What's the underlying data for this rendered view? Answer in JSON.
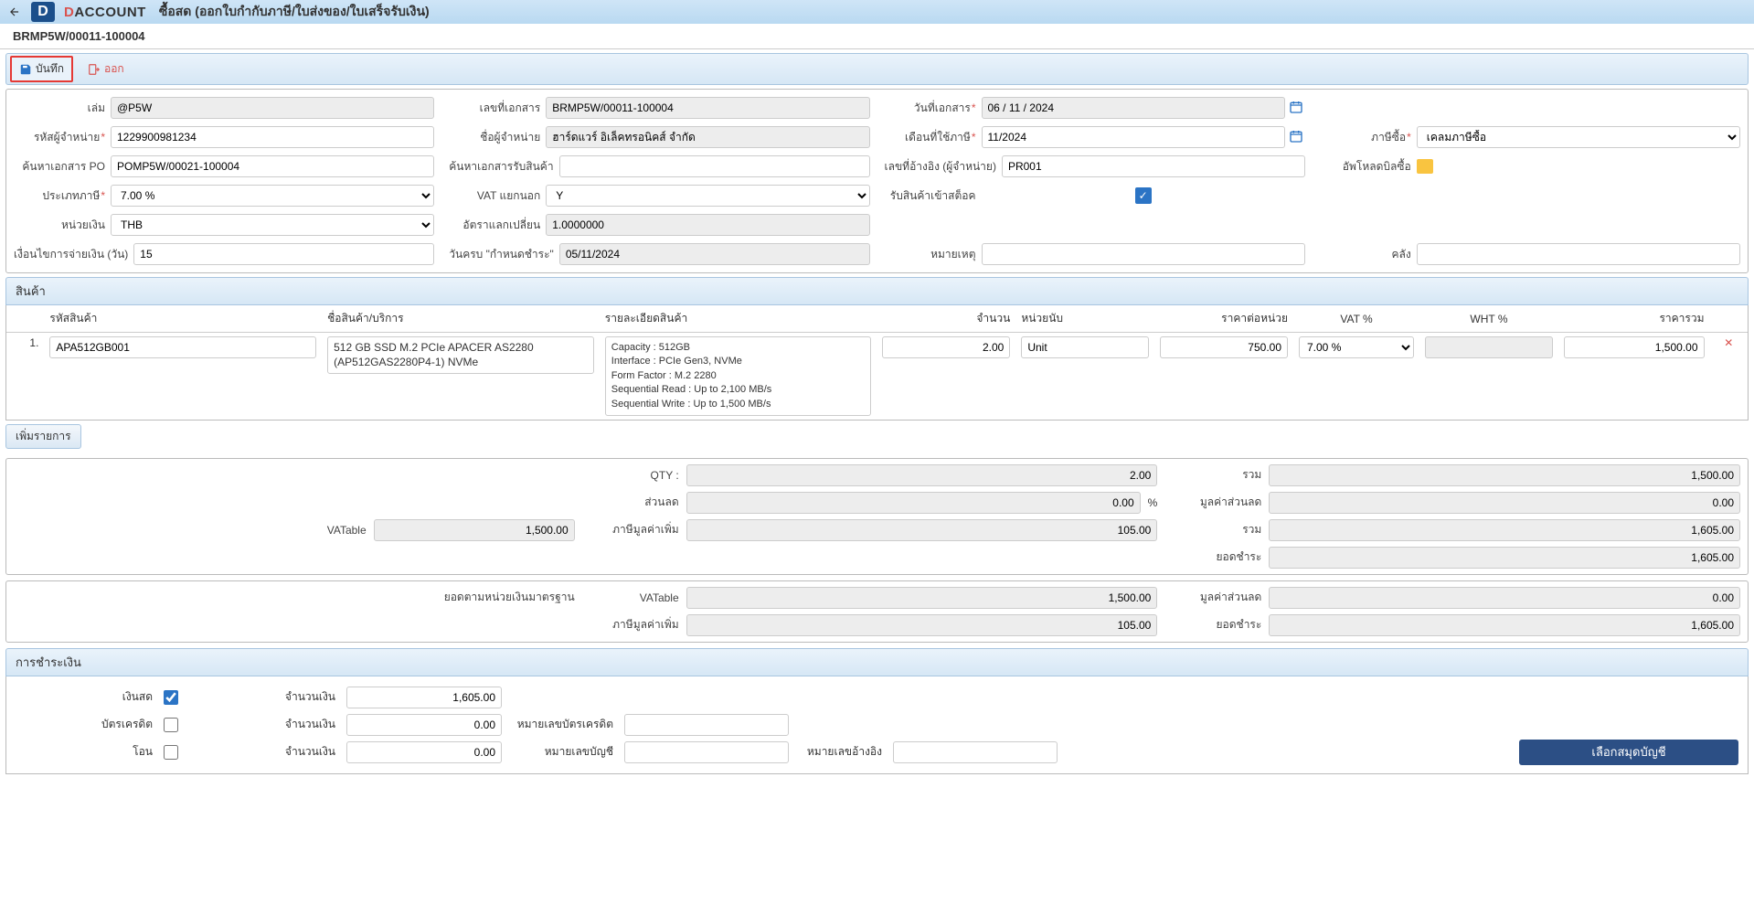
{
  "header": {
    "brand_prefix": "D",
    "brand_rest": "ACCOUNT",
    "page_title": "ซื้อสด (ออกใบกำกับภาษี/ใบส่งของ/ใบเสร็จรับเงิน)"
  },
  "doc_bar": {
    "doc_id": "BRMP5W/00011-100004"
  },
  "toolbar": {
    "save": "บันทึก",
    "exit": "ออก"
  },
  "form": {
    "book_label": "เล่ม",
    "book_value": "@P5W",
    "docno_label": "เลขที่เอกสาร",
    "docno_value": "BRMP5W/00011-100004",
    "docdate_label": "วันที่เอกสาร",
    "docdate_value": "06 / 11 / 2024",
    "vendorcode_label": "รหัสผู้จำหน่าย",
    "vendorcode_value": "1229900981234",
    "vendorname_label": "ชื่อผู้จำหน่าย",
    "vendorname_value": "ฮาร์ดแวร์ อิเล็คทรอนิคส์ จำกัด",
    "taxmonth_label": "เดือนที่ใช้ภาษี",
    "taxmonth_value": "11/2024",
    "buytax_label": "ภาษีซื้อ",
    "buytax_value": "เคลมภาษีซื้อ",
    "po_label": "ค้นหาเอกสาร PO",
    "po_value": "POMP5W/00021-100004",
    "recv_label": "ค้นหาเอกสารรับสินค้า",
    "recv_value": "",
    "ref_label": "เลขที่อ้างอิง (ผู้จำหน่าย)",
    "ref_value": "PR001",
    "upload_label": "อัพโหลดบิลซื้อ",
    "vattype_label": "ประเภทภาษี",
    "vattype_value": "7.00 %",
    "vatexcl_label": "VAT แยกนอก",
    "vatexcl_value": "Y",
    "stockin_label": "รับสินค้าเข้าสต็อค",
    "currency_label": "หน่วยเงิน",
    "currency_value": "THB",
    "rate_label": "อัตราแลกเปลี่ยน",
    "rate_value": "1.0000000",
    "credit_label": "เงื่อนไขการจ่ายเงิน (วัน)",
    "credit_value": "15",
    "due_label": "วันครบ \"กำหนดชำระ\"",
    "due_value": "05/11/2024",
    "note_label": "หมายเหตุ",
    "note_value": "",
    "warehouse_label": "คลัง",
    "warehouse_value": ""
  },
  "items_section": "สินค้า",
  "items": {
    "headers": {
      "code": "รหัสสินค้า",
      "name": "ชื่อสินค้า/บริการ",
      "detail": "รายละเอียดสินค้า",
      "qty": "จำนวน",
      "unit": "หน่วยนับ",
      "price": "ราคาต่อหน่วย",
      "vat": "VAT %",
      "wht": "WHT %",
      "total": "ราคารวม"
    },
    "rows": [
      {
        "no": "1.",
        "code": "APA512GB001",
        "name": "512 GB SSD M.2 PCIe APACER AS2280 (AP512GAS2280P4-1) NVMe",
        "detail": "Capacity : 512GB\nInterface : PCIe Gen3, NVMe\nForm Factor : M.2 2280\nSequential Read : Up to 2,100 MB/s\nSequential Write : Up to 1,500 MB/s",
        "qty": "2.00",
        "unit": "Unit",
        "price": "750.00",
        "vat": "7.00 %",
        "total": "1,500.00"
      }
    ]
  },
  "add_row": "เพิ่มรายการ",
  "totals": {
    "qty_label": "QTY :",
    "qty_value": "2.00",
    "sum_label": "รวม",
    "sum_value": "1,500.00",
    "discount_label": "ส่วนลด",
    "discount_value": "0.00",
    "discount_pct": "%",
    "discount_amt_label": "มูลค่าส่วนลด",
    "discount_amt_value": "0.00",
    "vatable_label": "VATable",
    "vatable_value": "1,500.00",
    "vat_label": "ภาษีมูลค่าเพิ่ม",
    "vat_value": "105.00",
    "grand_label": "รวม",
    "grand_value": "1,605.00",
    "pay_label": "ยอดชำระ",
    "pay_value": "1,605.00",
    "base_label": "ยอดตามหน่วยเงินมาตรฐาน",
    "base_vatable_label": "VATable",
    "base_vatable_value": "1,500.00",
    "base_discount_label": "มูลค่าส่วนลด",
    "base_discount_value": "0.00",
    "base_vat_label": "ภาษีมูลค่าเพิ่ม",
    "base_vat_value": "105.00",
    "base_pay_label": "ยอดชำระ",
    "base_pay_value": "1,605.00"
  },
  "payment": {
    "header": "การชำระเงิน",
    "cash": "เงินสด",
    "cash_amount_label": "จำนวนเงิน",
    "cash_amount": "1,605.00",
    "card": "บัตรเครดิต",
    "card_amount_label": "จำนวนเงิน",
    "card_amount": "0.00",
    "card_note_label": "หมายเลขบัตรเครดิต",
    "transfer": "โอน",
    "transfer_amount_label": "จำนวนเงิน",
    "transfer_amount": "0.00",
    "transfer_note_label": "หมายเลขบัญชี",
    "transfer_ref_label": "หมายเลขอ้างอิง",
    "select_account": "เลือกสมุดบัญชี"
  }
}
